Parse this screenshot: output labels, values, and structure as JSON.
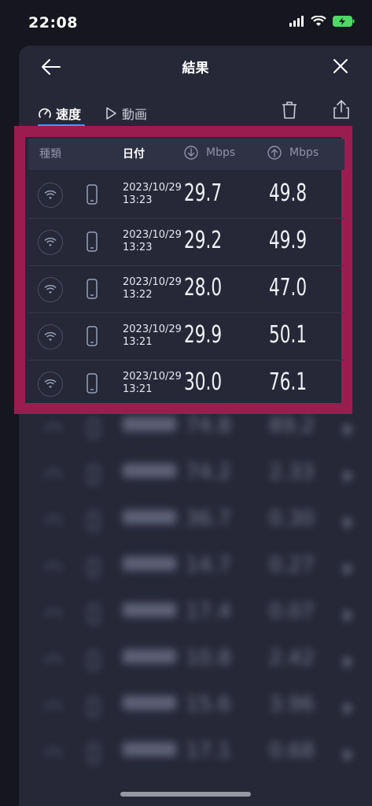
{
  "status": {
    "time": "22:08"
  },
  "header": {
    "title": "結果"
  },
  "tabs": {
    "speed": "速度",
    "video": "動画"
  },
  "table": {
    "col_type": "種類",
    "col_date": "日付",
    "col_down_unit": "Mbps",
    "col_up_unit": "Mbps",
    "rows": [
      {
        "date": "2023/10/29",
        "time": "13:23",
        "down": "29.7",
        "up": "49.8"
      },
      {
        "date": "2023/10/29",
        "time": "13:23",
        "down": "29.2",
        "up": "49.9"
      },
      {
        "date": "2023/10/29",
        "time": "13:22",
        "down": "28.0",
        "up": "47.0"
      },
      {
        "date": "2023/10/29",
        "time": "13:21",
        "down": "29.9",
        "up": "50.1"
      },
      {
        "date": "2023/10/29",
        "time": "13:21",
        "down": "30.0",
        "up": "76.1"
      }
    ]
  },
  "blurred_rows": [
    {
      "down": "74.8",
      "up": "89.2"
    },
    {
      "down": "74.2",
      "up": "2.33"
    },
    {
      "down": "36.7",
      "up": "0.30"
    },
    {
      "down": "14.7",
      "up": "0.27"
    },
    {
      "down": "17.4",
      "up": "0.07"
    },
    {
      "down": "10.8",
      "up": "2.42"
    },
    {
      "down": "15.6",
      "up": "3.96"
    },
    {
      "down": "17.1",
      "up": "0.68"
    }
  ],
  "colors": {
    "accent": "#3aa0ff",
    "highlight": "#9b1d50",
    "battery": "#4cd964"
  }
}
